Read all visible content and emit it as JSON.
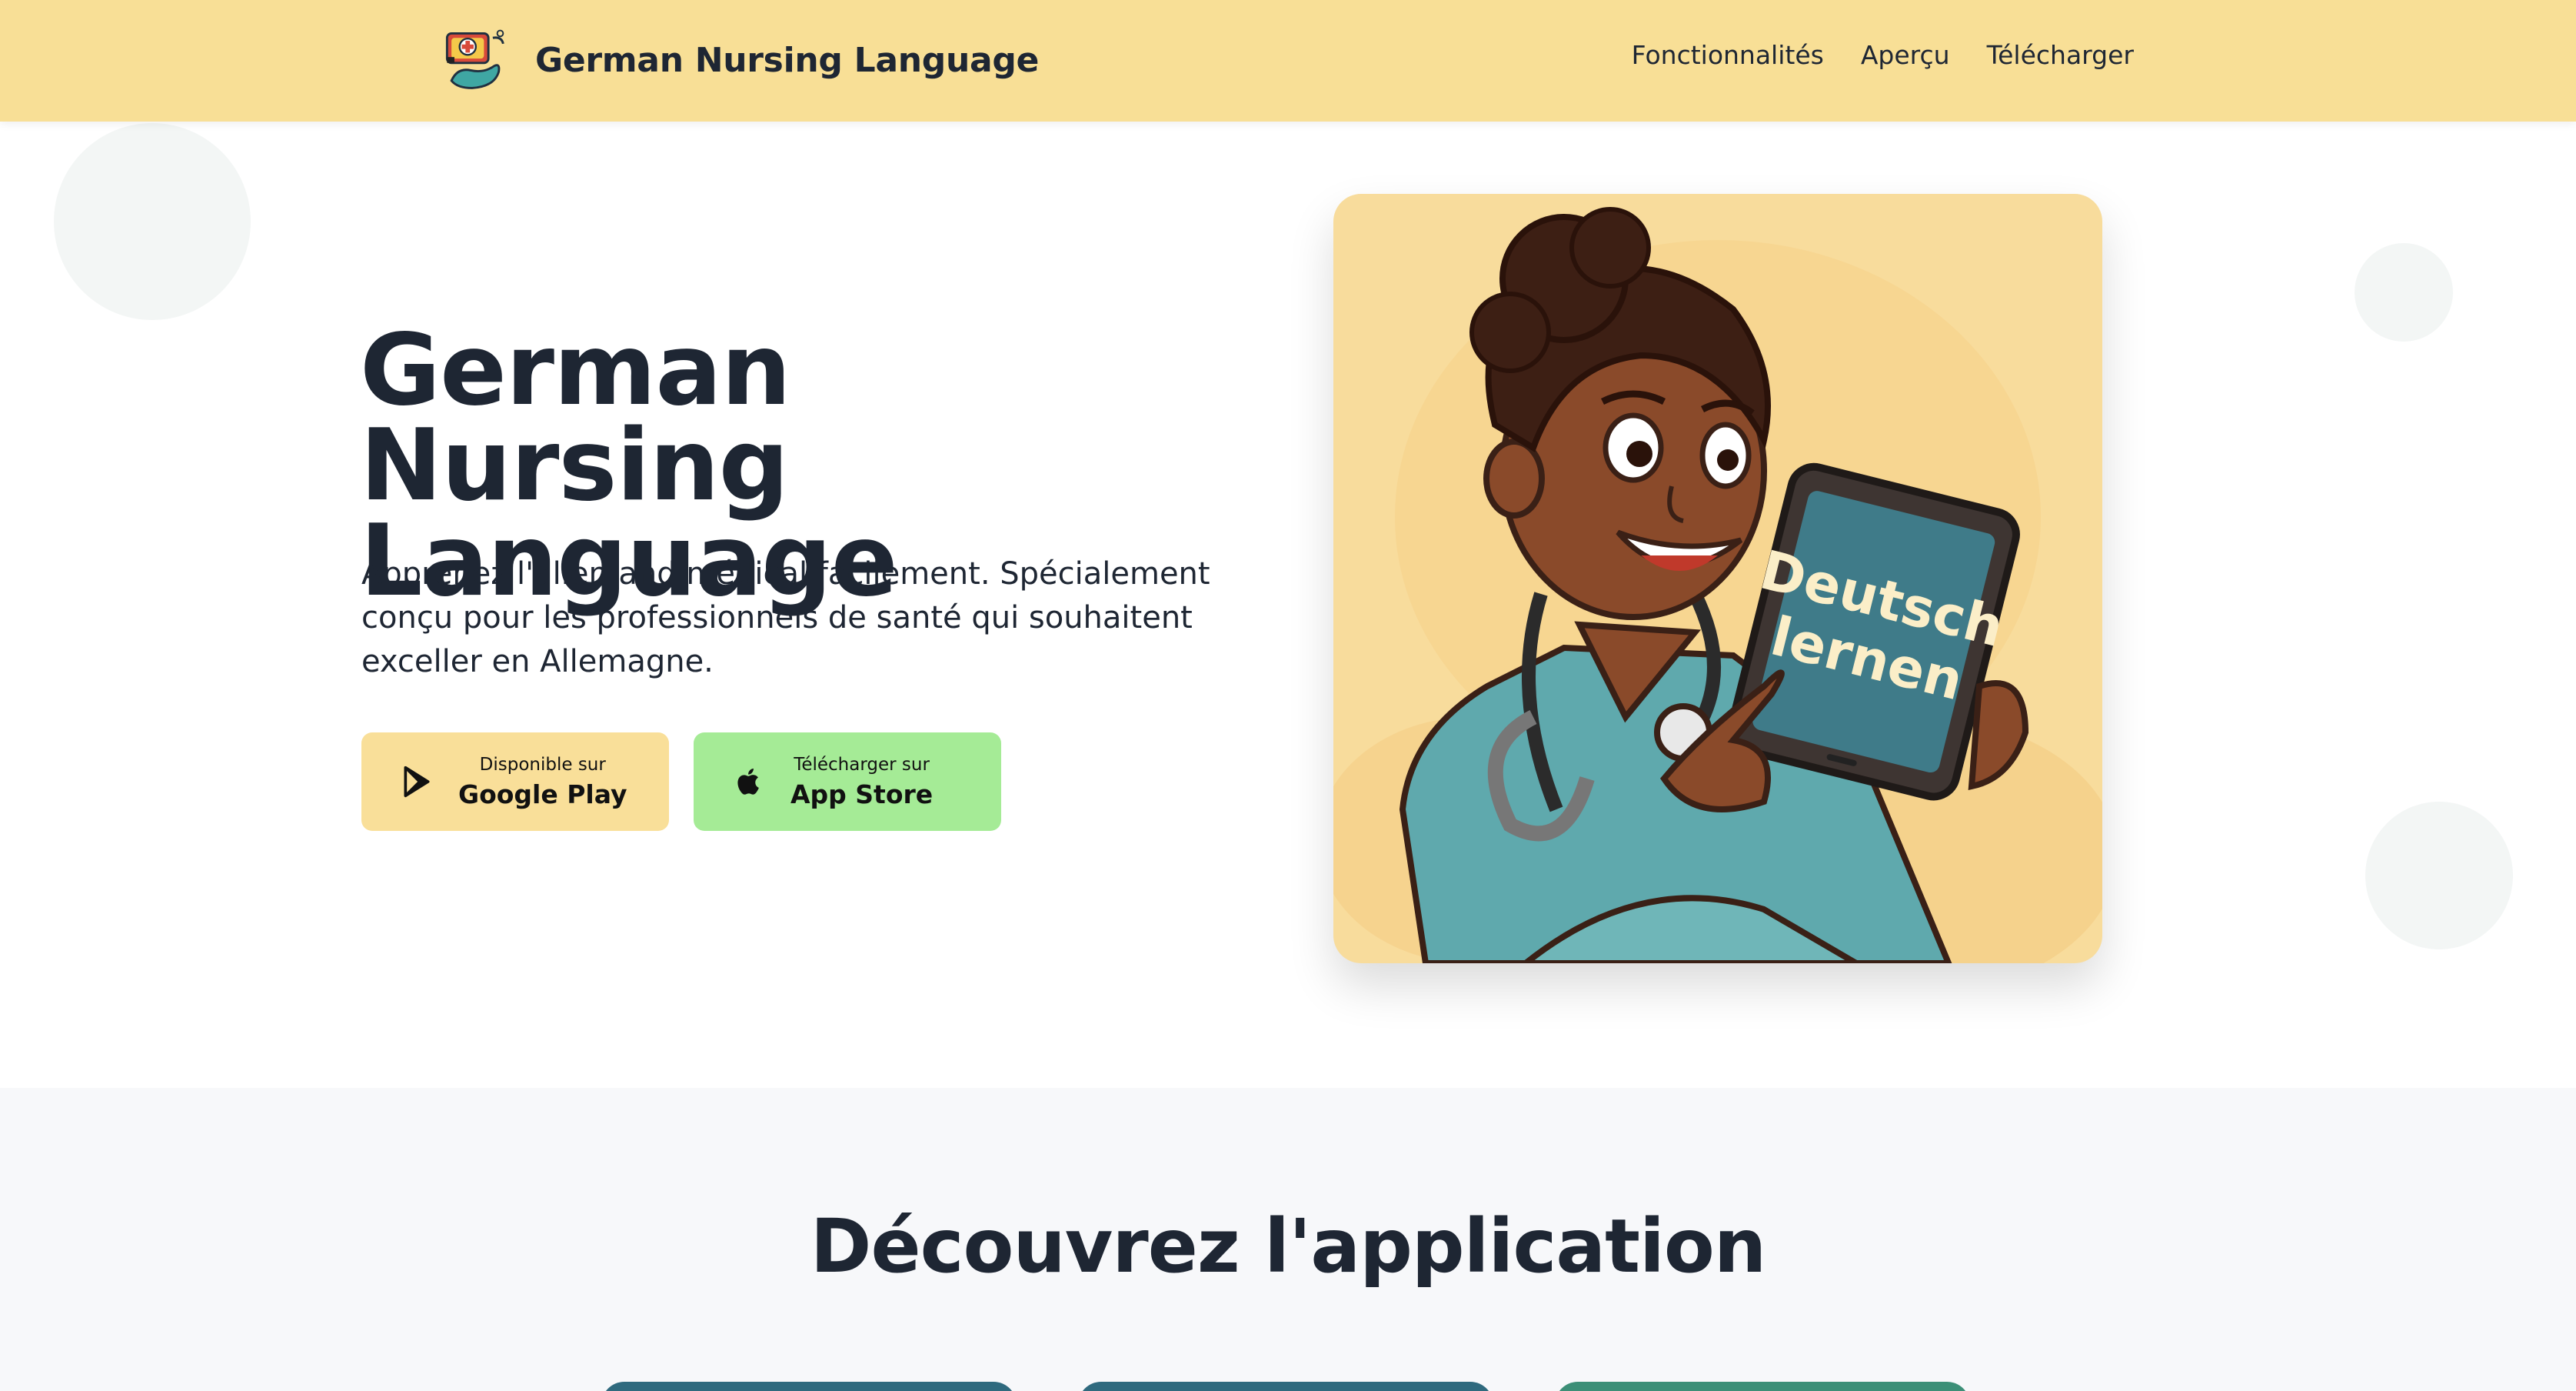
{
  "header": {
    "brand_name": "German Nursing Language",
    "nav": [
      {
        "label": "Fonctionnalités"
      },
      {
        "label": "Aperçu"
      },
      {
        "label": "Télécharger"
      }
    ]
  },
  "hero": {
    "title": "German Nursing Language",
    "subtitle": "Apprenez l'allemand médical facilement. Spécialement conçu pour les professionnels de santé qui souhaitent exceller en Allemagne.",
    "buttons": {
      "google": {
        "small": "Disponible sur",
        "big": "Google Play",
        "icon": "google-play-icon"
      },
      "apple": {
        "small": "Télécharger sur",
        "big": "App Store",
        "icon": "apple-icon"
      }
    },
    "illustration": {
      "tablet_line1": "Deutsch",
      "tablet_line2": "lernen"
    }
  },
  "section_features": {
    "title": "Découvrez l'application"
  },
  "colors": {
    "header_bg": "#f8df96",
    "google_btn": "#f9df99",
    "apple_btn": "#a5eb96",
    "text_dark": "#1e2633",
    "section_bg": "#f7f8fa"
  }
}
